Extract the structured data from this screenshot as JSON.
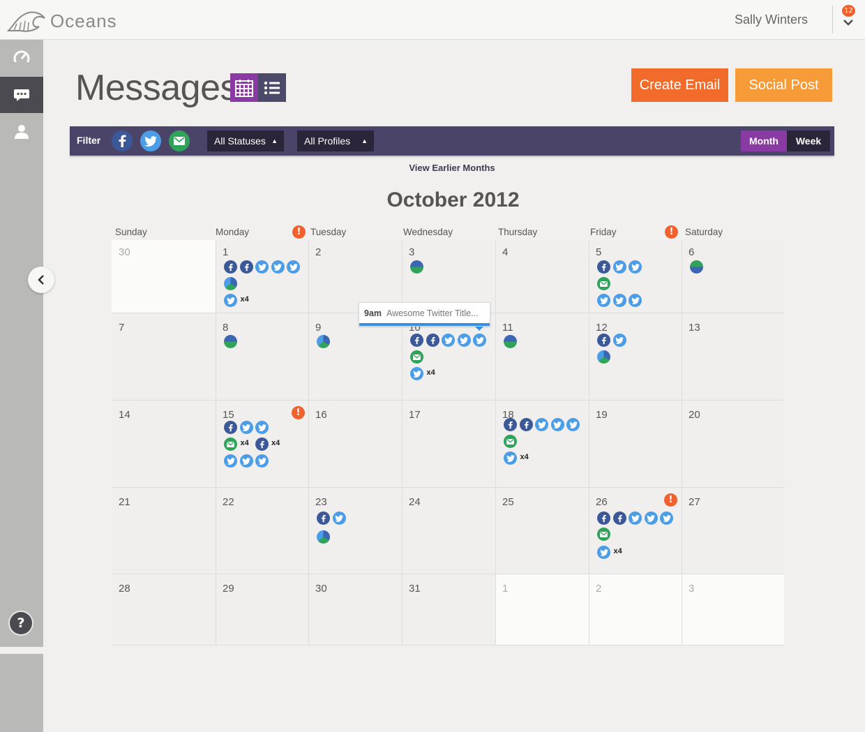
{
  "app": {
    "name": "Oceans",
    "user": "Sally Winters",
    "notifications": "12"
  },
  "page": {
    "title": "Messages"
  },
  "buttons": {
    "create_email": "Create Email",
    "social_post": "Social Post"
  },
  "filter": {
    "label": "Filter",
    "status": "All Statuses",
    "profiles": "All Profiles",
    "month": "Month",
    "week": "Week"
  },
  "calendar": {
    "earlier": "View Earlier Months",
    "month_title": "October 2012",
    "days": [
      "Sunday",
      "Monday",
      "Tuesday",
      "Wednesday",
      "Thursday",
      "Friday",
      "Saturday"
    ],
    "dates": [
      "30",
      "1",
      "2",
      "3",
      "4",
      "5",
      "6",
      "7",
      "8",
      "9",
      "10",
      "11",
      "12",
      "13",
      "14",
      "15",
      "16",
      "17",
      "18",
      "19",
      "20",
      "21",
      "22",
      "23",
      "24",
      "25",
      "26",
      "27",
      "28",
      "29",
      "30",
      "31",
      "1",
      "2",
      "3"
    ],
    "multiplier": "x4"
  },
  "tooltip": {
    "time": "9am",
    "text": "Awesome Twitter Title..."
  },
  "help": "?",
  "colors": {
    "accent_purple": "#8a3aa3",
    "filterbar": "#4a4568",
    "orange": "#f26b2b",
    "light_orange": "#f79a38",
    "alert": "#f0612d"
  }
}
